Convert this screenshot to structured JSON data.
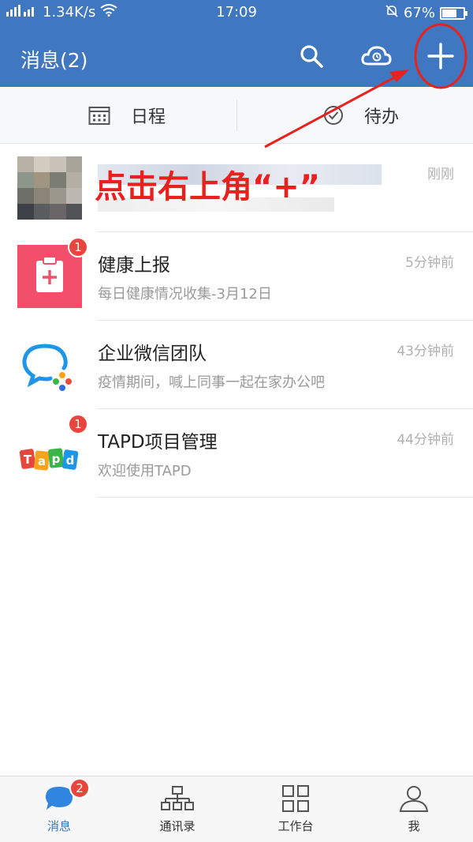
{
  "status_bar": {
    "network_speed": "1.34K/s",
    "time": "17:09",
    "battery": "67%"
  },
  "header": {
    "title": "消息(2)",
    "icons": [
      "search-icon",
      "cloud-icon",
      "plus-icon"
    ]
  },
  "subtabs": [
    {
      "label": "日程",
      "icon": "calendar-icon"
    },
    {
      "label": "待办",
      "icon": "check-circle-icon"
    }
  ],
  "messages": [
    {
      "title": "",
      "preview": "",
      "time": "刚刚",
      "avatar": "blurred-photo"
    },
    {
      "title": "健康上报",
      "preview": "每日健康情况收集-3月12日",
      "time": "5分钟前",
      "badge": "1",
      "avatar": "health-report-icon"
    },
    {
      "title": "企业微信团队",
      "preview": "疫情期间，喊上同事一起在家办公吧",
      "time": "43分钟前",
      "avatar": "wework-logo"
    },
    {
      "title": "TAPD项目管理",
      "preview": "欢迎使用TAPD",
      "time": "44分钟前",
      "badge": "1",
      "avatar": "tapd-logo",
      "logo_text": "TAPD"
    }
  ],
  "annotation": {
    "text": "点击右上角“+”",
    "color": "#e8211d"
  },
  "bottom_nav": [
    {
      "label": "消息",
      "badge": "2",
      "active": true
    },
    {
      "label": "通讯录"
    },
    {
      "label": "工作台"
    },
    {
      "label": "我"
    }
  ],
  "colors": {
    "brand": "#3f77c0",
    "badge": "#e8453c",
    "health_icon": "#f2506a"
  }
}
